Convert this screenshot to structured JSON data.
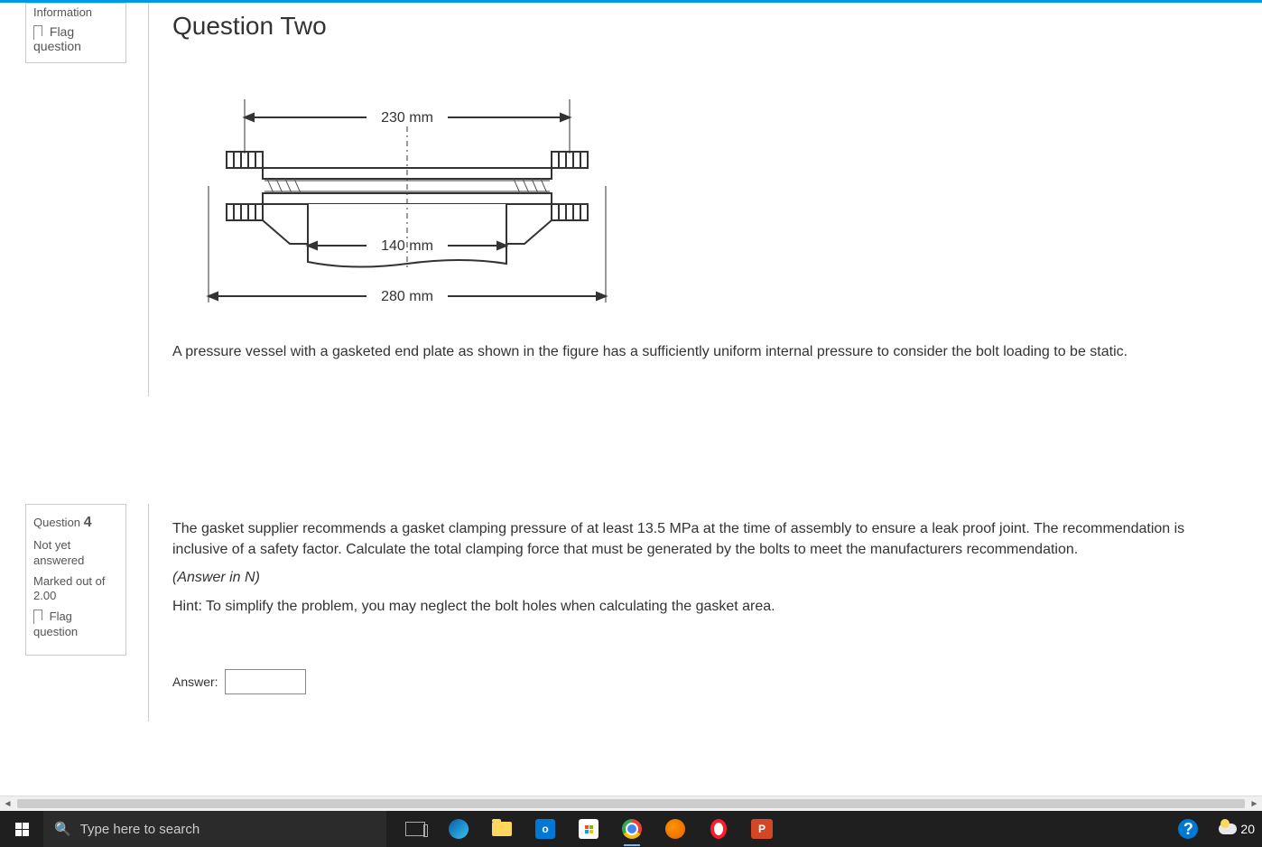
{
  "info_block": {
    "label": "Information",
    "flag_text": "Flag question"
  },
  "question2": {
    "title": "Question Two",
    "dim_top": "230 mm",
    "dim_mid": "140 mm",
    "dim_bot": "280 mm",
    "text": "A pressure vessel with a gasketed end plate as shown in the figure has a sufficiently uniform internal pressure to consider the bolt loading to be static."
  },
  "q4_info": {
    "qlabel": "Question",
    "qnum": "4",
    "status": "Not yet answered",
    "marked": "Marked out of 2.00",
    "flag_text": "Flag question"
  },
  "q4": {
    "para": "The gasket supplier recommends a gasket clamping pressure of at least 13.5 MPa at the time of assembly  to ensure a leak proof joint. The recommendation is inclusive of a safety factor. Calculate the total clamping force that must be generated by the bolts to meet the manufacturers recommendation.",
    "unit": "(Answer in N)",
    "hint": "Hint: To simplify the problem, you may neglect the bolt holes when calculating the gasket area.",
    "answer_label": "Answer:"
  },
  "taskbar": {
    "search_placeholder": "Type here to search",
    "outlook": "o",
    "pp": "P",
    "help": "?",
    "temp": "20"
  }
}
